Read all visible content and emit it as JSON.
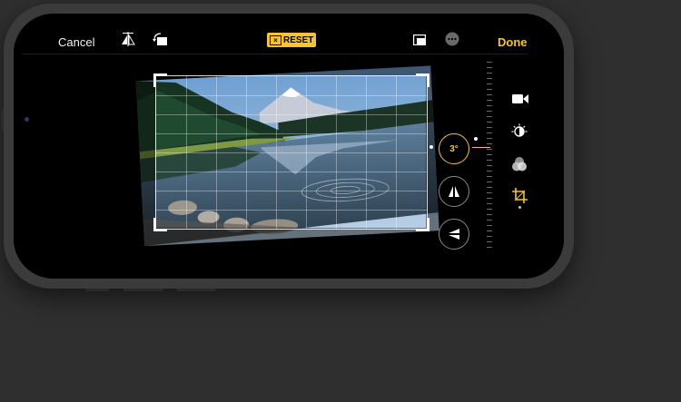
{
  "toolbar": {
    "cancel_label": "Cancel",
    "reset_label": "RESET",
    "done_label": "Done",
    "icons": [
      "flip-horizontal-icon",
      "rotate-icon",
      "aspect-ratio-icon",
      "more-icon"
    ]
  },
  "adjustments": {
    "straighten_value": "3°",
    "items": [
      "straighten-icon",
      "vertical-perspective-icon",
      "horizontal-perspective-icon"
    ]
  },
  "tools": {
    "items": [
      "video-icon",
      "adjust-icon",
      "filters-icon",
      "crop-icon"
    ],
    "active": "crop-icon"
  },
  "colors": {
    "accent": "#f7c52b",
    "background": "#2f2f2f",
    "screen": "#000000"
  }
}
